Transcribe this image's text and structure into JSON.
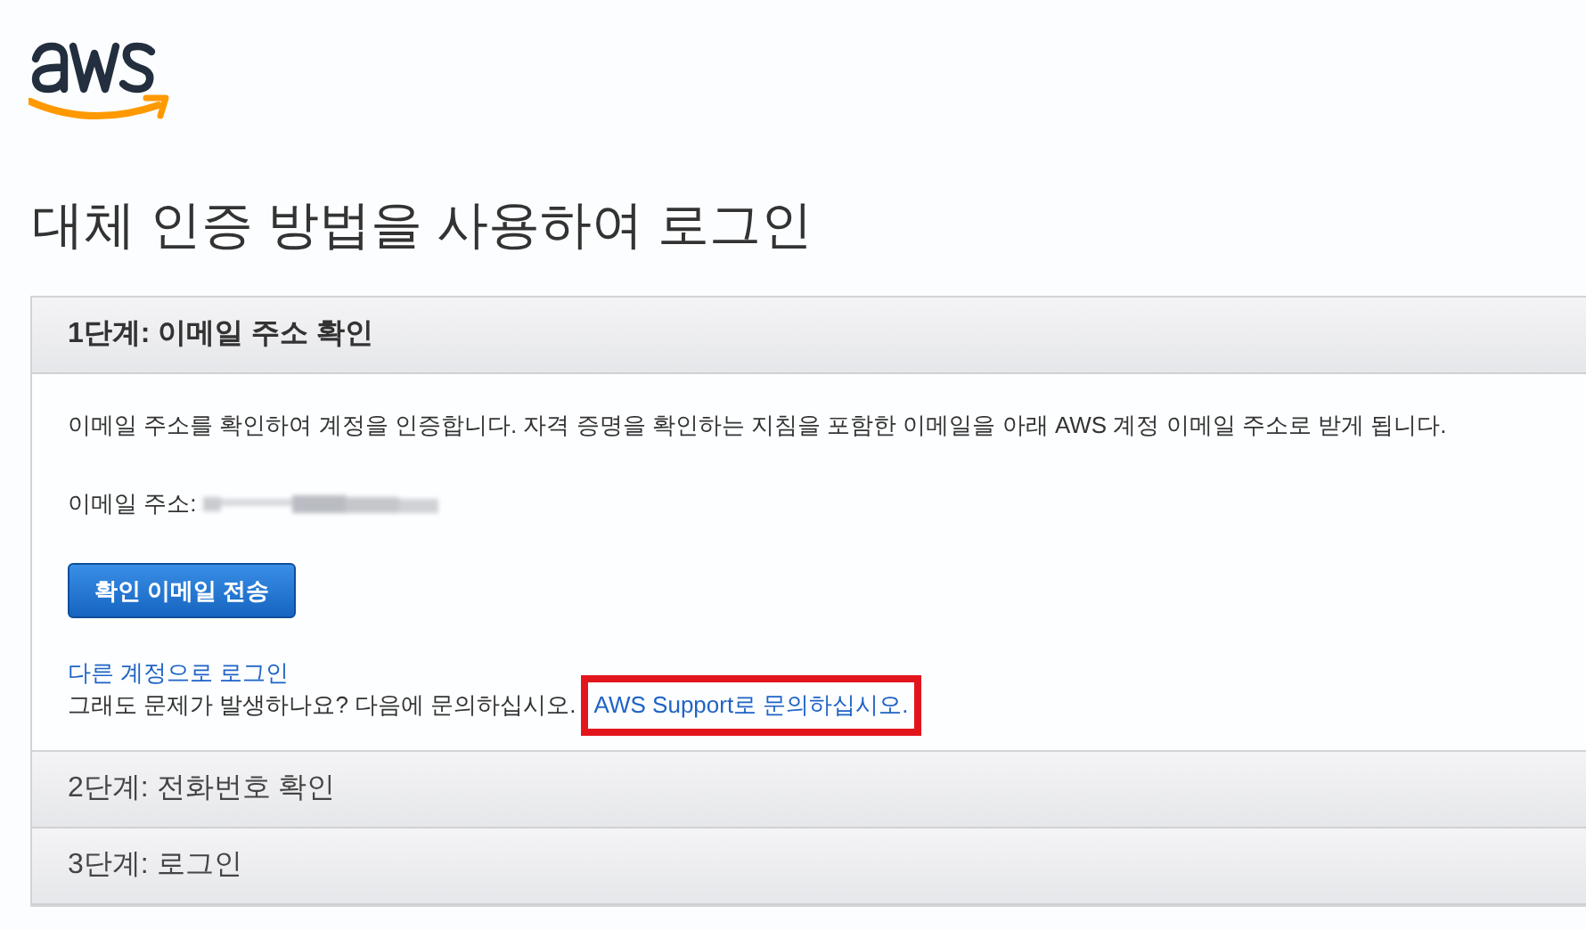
{
  "page": {
    "title": "대체 인증 방법을 사용하여 로그인"
  },
  "steps": [
    {
      "title": "1단계: 이메일 주소 확인",
      "expanded": true
    },
    {
      "title": "2단계: 전화번호 확인",
      "expanded": false
    },
    {
      "title": "3단계: 로그인",
      "expanded": false
    }
  ],
  "step_1": {
    "description": "이메일 주소를 확인하여 계정을 인증합니다. 자격 증명을 확인하는 지침을 포함한 이메일을 아래 AWS 계정 이메일 주소로 받게 됩니다.",
    "email_label": "이메일 주소:",
    "send_button": "확인 이메일 전송",
    "other_account_link": "다른 계정으로 로그인",
    "help_text": "그래도 문제가 발생하나요? 다음에 문의하십시오.",
    "support_link": "AWS Support로 문의하십시오.",
    "support_link_highlighted": true
  }
}
